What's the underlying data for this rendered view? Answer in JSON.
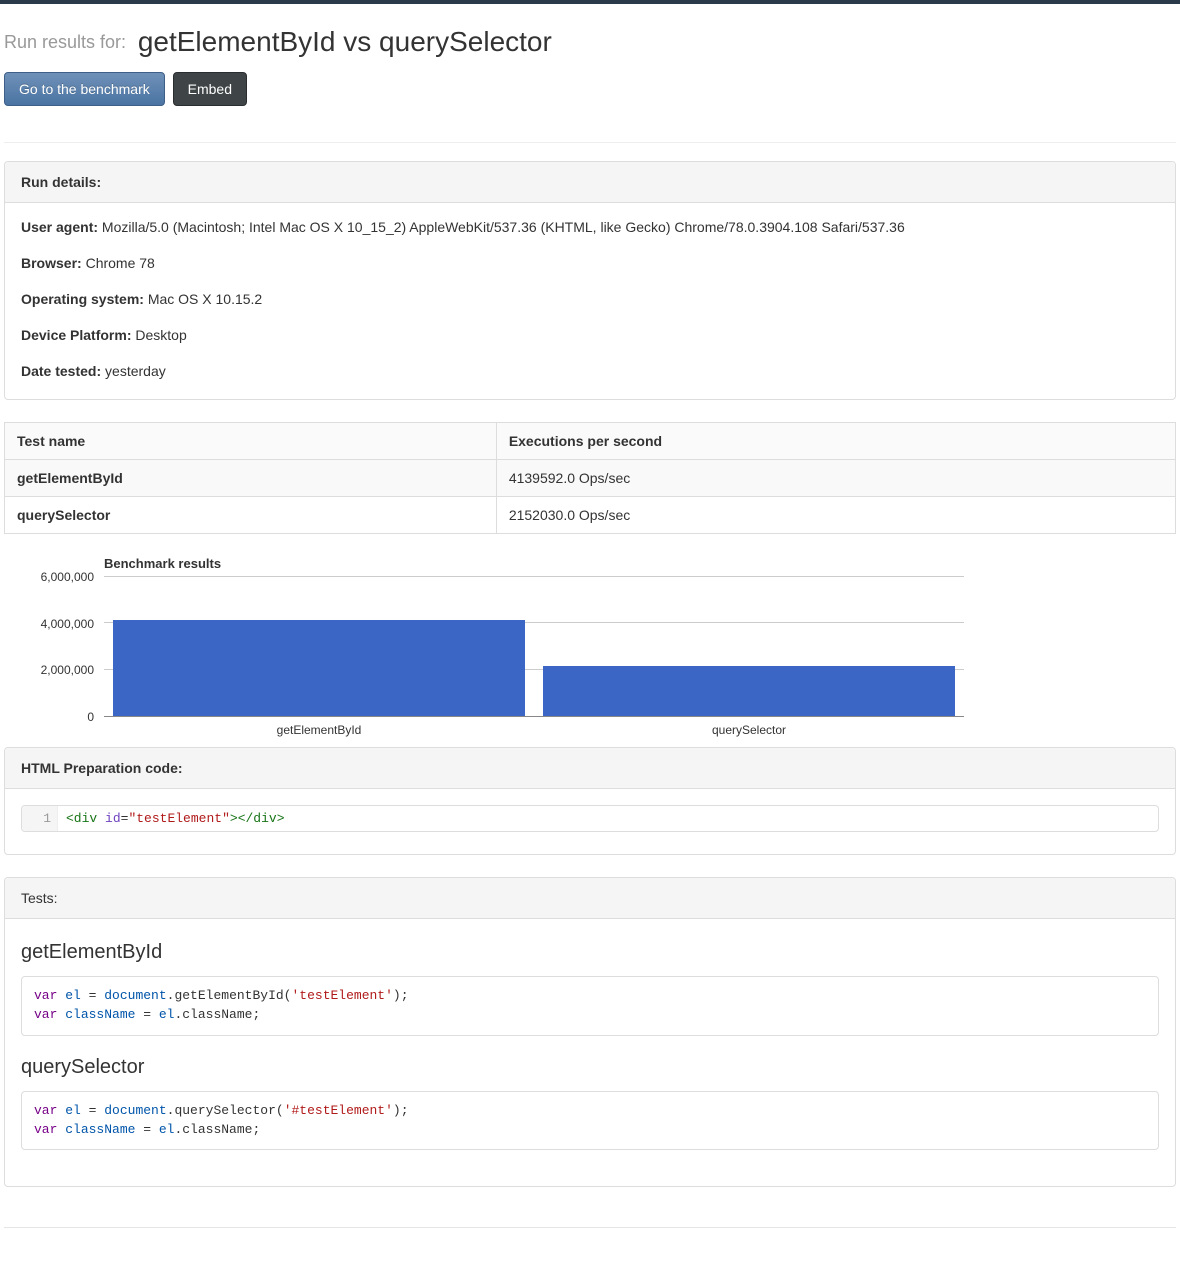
{
  "header": {
    "prefix": "Run results for:",
    "title": "getElementById vs querySelector",
    "buttons": {
      "go": "Go to the benchmark",
      "embed": "Embed"
    }
  },
  "run_details": {
    "heading": "Run details:",
    "rows": [
      {
        "label": "User agent:",
        "value": "Mozilla/5.0 (Macintosh; Intel Mac OS X 10_15_2) AppleWebKit/537.36 (KHTML, like Gecko) Chrome/78.0.3904.108 Safari/537.36"
      },
      {
        "label": "Browser:",
        "value": "Chrome 78"
      },
      {
        "label": "Operating system:",
        "value": "Mac OS X 10.15.2"
      },
      {
        "label": "Device Platform:",
        "value": "Desktop"
      },
      {
        "label": "Date tested:",
        "value": "yesterday"
      }
    ]
  },
  "results_table": {
    "columns": [
      "Test name",
      "Executions per second"
    ],
    "rows": [
      {
        "name": "getElementById",
        "eps": "4139592.0 Ops/sec"
      },
      {
        "name": "querySelector",
        "eps": "2152030.0 Ops/sec"
      }
    ]
  },
  "chart_data": {
    "type": "bar",
    "title": "Benchmark results",
    "categories": [
      "getElementById",
      "querySelector"
    ],
    "values": [
      4139592,
      2152030
    ],
    "ylabel": "",
    "ylim": [
      0,
      6000000
    ],
    "yticks": [
      0,
      2000000,
      4000000,
      6000000
    ],
    "ytick_labels": [
      "0",
      "2,000,000",
      "4,000,000",
      "6,000,000"
    ],
    "bar_color": "#3b66c5"
  },
  "html_prep": {
    "heading": "HTML Preparation code:",
    "line_no": "1",
    "tokens": [
      {
        "t": "<div",
        "c": "tok-tag"
      },
      {
        "t": " ",
        "c": "tok-plain"
      },
      {
        "t": "id",
        "c": "tok-attr"
      },
      {
        "t": "=",
        "c": "tok-plain"
      },
      {
        "t": "\"testElement\"",
        "c": "tok-str"
      },
      {
        "t": ">",
        "c": "tok-tag"
      },
      {
        "t": "</div>",
        "c": "tok-tag"
      }
    ]
  },
  "tests_panel": {
    "heading": "Tests:"
  },
  "tests": [
    {
      "title": "getElementById",
      "lines": [
        [
          {
            "t": "var",
            "c": "tok-kw"
          },
          {
            "t": " ",
            "c": "tok-plain"
          },
          {
            "t": "el",
            "c": "tok-ident"
          },
          {
            "t": " = ",
            "c": "tok-plain"
          },
          {
            "t": "document",
            "c": "tok-ident"
          },
          {
            "t": ".getElementById(",
            "c": "tok-plain"
          },
          {
            "t": "'testElement'",
            "c": "tok-str"
          },
          {
            "t": ");",
            "c": "tok-plain"
          }
        ],
        [
          {
            "t": "var",
            "c": "tok-kw"
          },
          {
            "t": " ",
            "c": "tok-plain"
          },
          {
            "t": "className",
            "c": "tok-ident"
          },
          {
            "t": " = ",
            "c": "tok-plain"
          },
          {
            "t": "el",
            "c": "tok-ident"
          },
          {
            "t": ".className;",
            "c": "tok-plain"
          }
        ]
      ]
    },
    {
      "title": "querySelector",
      "lines": [
        [
          {
            "t": "var",
            "c": "tok-kw"
          },
          {
            "t": " ",
            "c": "tok-plain"
          },
          {
            "t": "el",
            "c": "tok-ident"
          },
          {
            "t": " = ",
            "c": "tok-plain"
          },
          {
            "t": "document",
            "c": "tok-ident"
          },
          {
            "t": ".querySelector(",
            "c": "tok-plain"
          },
          {
            "t": "'#testElement'",
            "c": "tok-str"
          },
          {
            "t": ");",
            "c": "tok-plain"
          }
        ],
        [
          {
            "t": "var",
            "c": "tok-kw"
          },
          {
            "t": " ",
            "c": "tok-plain"
          },
          {
            "t": "className",
            "c": "tok-ident"
          },
          {
            "t": " = ",
            "c": "tok-plain"
          },
          {
            "t": "el",
            "c": "tok-ident"
          },
          {
            "t": ".className;",
            "c": "tok-plain"
          }
        ]
      ]
    }
  ]
}
